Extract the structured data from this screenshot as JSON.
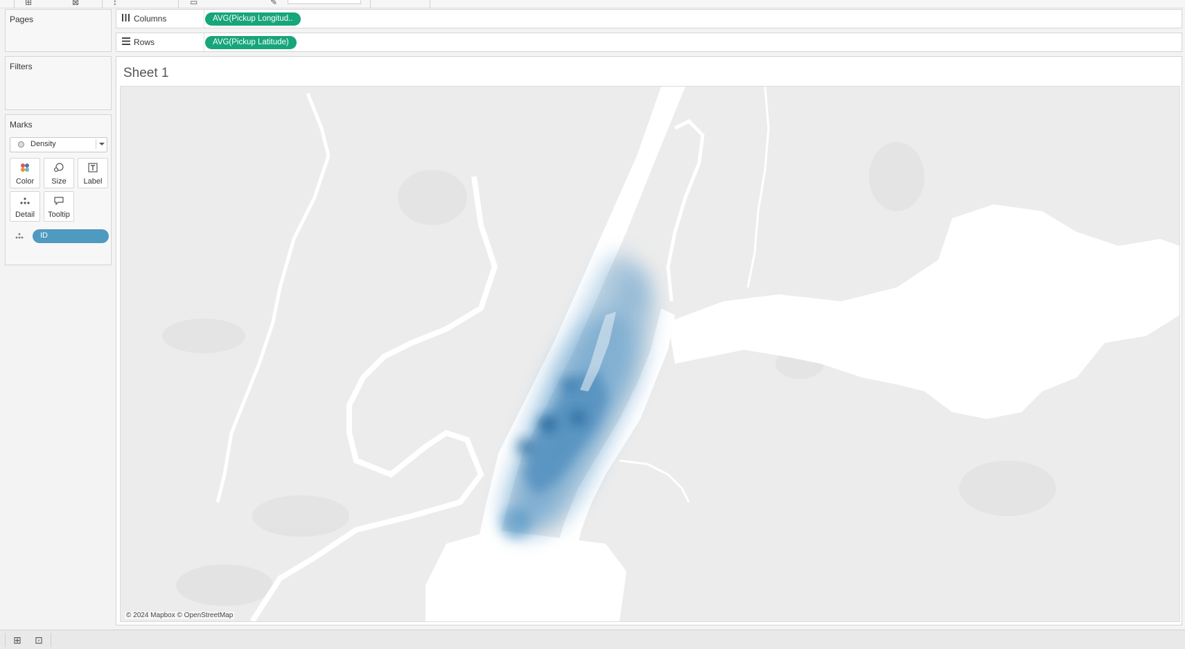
{
  "toolbar": {
    "icons": [
      "new-data-source-icon",
      "clear-sheet-icon",
      "sort-icon",
      "group-icon",
      "highlight-icon"
    ]
  },
  "panels": {
    "pages_title": "Pages",
    "filters_title": "Filters",
    "marks_title": "Marks"
  },
  "marks": {
    "mark_type": "Density",
    "buttons": {
      "color": "Color",
      "size": "Size",
      "label": "Label",
      "detail": "Detail",
      "tooltip": "Tooltip"
    },
    "detail_pill": "ID",
    "detail_pill_color": "#4f9ac0"
  },
  "shelves": {
    "columns_label": "Columns",
    "columns_pill": "AVG(Pickup Longitud..",
    "rows_label": "Rows",
    "rows_pill": "AVG(Pickup Latitude)",
    "pill_color": "#17a57a"
  },
  "sheet": {
    "title": "Sheet 1",
    "attribution": "© 2024 Mapbox © OpenStreetMap",
    "density_color": "#4a90c4",
    "land_color": "#ececec",
    "water_color": "#ffffff"
  },
  "bottom_bar": {
    "icons": [
      "new-worksheet-icon",
      "new-dashboard-icon",
      "new-story-icon"
    ]
  }
}
